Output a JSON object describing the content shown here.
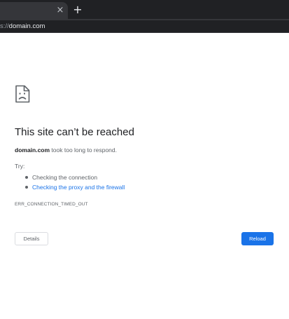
{
  "browser": {
    "tab": {
      "close_glyph": "×",
      "close_icon": "close-icon"
    },
    "new_tab": {
      "glyph": "+",
      "icon": "plus-icon"
    },
    "address_bar": {
      "scheme_fragment": "s://",
      "host": "domain.com"
    }
  },
  "error_page": {
    "icon": "sad-page-icon",
    "heading": "This site can’t be reached",
    "description": {
      "host": "domain.com",
      "message": " took too long to respond."
    },
    "try_label": "Try:",
    "suggestions": [
      {
        "text": "Checking the connection",
        "is_link": false
      },
      {
        "text": "Checking the proxy and the firewall",
        "is_link": true
      }
    ],
    "error_code": "ERR_CONNECTION_TIMED_OUT",
    "buttons": {
      "details": "Details",
      "reload": "Reload"
    }
  },
  "colors": {
    "tabbar_bg": "#202124",
    "toolbar_bg": "#35363a",
    "link": "#1a73e8",
    "primary_button": "#1a73e8",
    "heading_text": "#202124",
    "secondary_text": "#5f6368"
  }
}
